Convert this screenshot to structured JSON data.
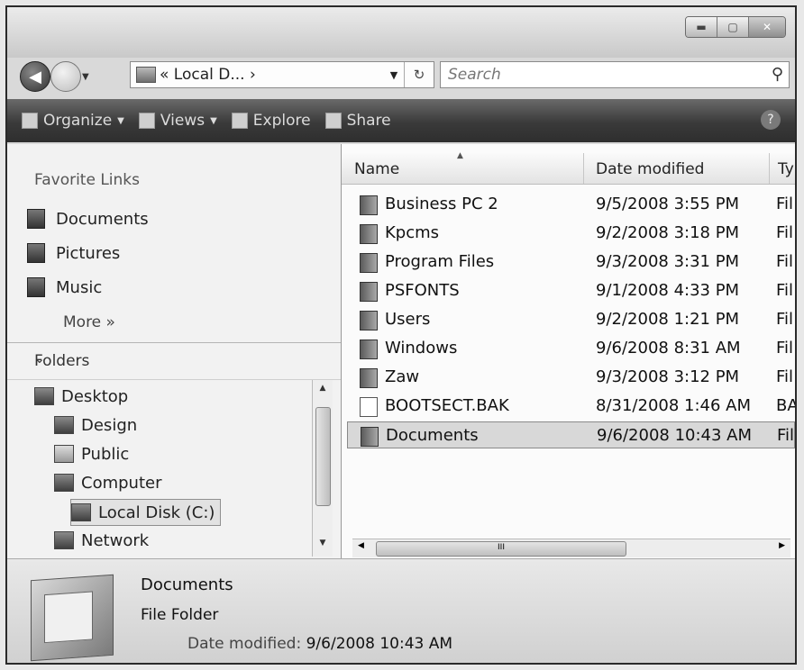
{
  "window": {
    "minimize_icon": "minimize-icon",
    "maximize_icon": "maximize-icon",
    "close_icon": "close-icon"
  },
  "nav": {
    "address": "« Local D... ›",
    "search_placeholder": "Search"
  },
  "toolbar": {
    "organize": "Organize",
    "views": "Views",
    "explore": "Explore",
    "share": "Share",
    "help": "?"
  },
  "left": {
    "favorites_title": "Favorite Links",
    "favorites": [
      "Documents",
      "Pictures",
      "Music"
    ],
    "more": "More  »",
    "folders_title": "Folders",
    "tree": [
      {
        "label": "Desktop",
        "level": 0
      },
      {
        "label": "Design",
        "level": 1
      },
      {
        "label": "Public",
        "level": 1
      },
      {
        "label": "Computer",
        "level": 1
      },
      {
        "label": "Local Disk (C:)",
        "level": 2,
        "selected": true
      },
      {
        "label": "Network",
        "level": 1
      }
    ]
  },
  "list": {
    "columns": [
      "Name",
      "Date modified",
      "Ty"
    ],
    "rows": [
      {
        "name": "Business PC 2",
        "date": "9/5/2008 3:55 PM",
        "type": "Fil"
      },
      {
        "name": "Kpcms",
        "date": "9/2/2008 3:18 PM",
        "type": "Fil"
      },
      {
        "name": "Program Files",
        "date": "9/3/2008 3:31 PM",
        "type": "Fil"
      },
      {
        "name": "PSFONTS",
        "date": "9/1/2008 4:33 PM",
        "type": "Fil"
      },
      {
        "name": "Users",
        "date": "9/2/2008 1:21 PM",
        "type": "Fil"
      },
      {
        "name": "Windows",
        "date": "9/6/2008 8:31 AM",
        "type": "Fil"
      },
      {
        "name": "Zaw",
        "date": "9/3/2008 3:12 PM",
        "type": "Fil"
      },
      {
        "name": "BOOTSECT.BAK",
        "date": "8/31/2008 1:46 AM",
        "type": "BA"
      },
      {
        "name": "Documents",
        "date": "9/6/2008 10:43 AM",
        "type": "Fil",
        "selected": true
      }
    ]
  },
  "details": {
    "name": "Documents",
    "type": "File Folder",
    "date_label": "Date modified:",
    "date_value": "9/6/2008 10:43 AM"
  }
}
